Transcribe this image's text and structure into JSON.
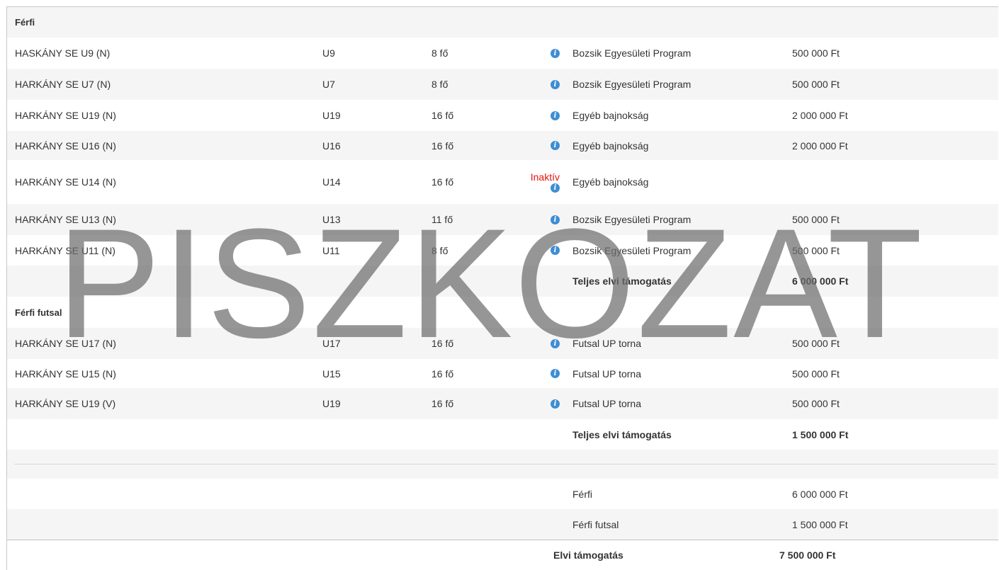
{
  "sections": [
    {
      "title": "Férfi",
      "rows": [
        {
          "name": "HASKÁNY SE U9 (N)",
          "age": "U9",
          "count": "8 fő",
          "program": "Bozsik Egyesületi Program",
          "amount": "500 000 Ft",
          "status": ""
        },
        {
          "name": "HARKÁNY SE U7 (N)",
          "age": "U7",
          "count": "8 fő",
          "program": "Bozsik Egyesületi Program",
          "amount": "500 000 Ft",
          "status": ""
        },
        {
          "name": "HARKÁNY SE U19 (N)",
          "age": "U19",
          "count": "16 fő",
          "program": "Egyéb bajnokság",
          "amount": "2 000 000 Ft",
          "status": ""
        },
        {
          "name": "HARKÁNY SE U16 (N)",
          "age": "U16",
          "count": "16 fő",
          "program": "Egyéb bajnokság",
          "amount": "2 000 000 Ft",
          "status": ""
        },
        {
          "name": "HARKÁNY SE U14 (N)",
          "age": "U14",
          "count": "16 fő",
          "program": "Egyéb bajnokság",
          "amount": "",
          "status": "Inaktív"
        },
        {
          "name": "HARKÁNY SE U13 (N)",
          "age": "U13",
          "count": "11 fő",
          "program": "Bozsik Egyesületi Program",
          "amount": "500 000 Ft",
          "status": ""
        },
        {
          "name": "HARKÁNY SE U11 (N)",
          "age": "U11",
          "count": "8 fő",
          "program": "Bozsik Egyesületi Program",
          "amount": "500 000 Ft",
          "status": ""
        }
      ],
      "total_label": "Teljes elvi támogatás",
      "total_amount": "6 000 000 Ft"
    },
    {
      "title": "Férfi futsal",
      "rows": [
        {
          "name": "HARKÁNY SE U17 (N)",
          "age": "U17",
          "count": "16 fő",
          "program": "Futsal UP torna",
          "amount": "500 000 Ft",
          "status": ""
        },
        {
          "name": "HARKÁNY SE U15 (N)",
          "age": "U15",
          "count": "16 fő",
          "program": "Futsal UP torna",
          "amount": "500 000 Ft",
          "status": ""
        },
        {
          "name": "HARKÁNY SE U19 (V)",
          "age": "U19",
          "count": "16 fő",
          "program": "Futsal UP torna",
          "amount": "500 000 Ft",
          "status": ""
        }
      ],
      "total_label": "Teljes elvi támogatás",
      "total_amount": "1 500 000 Ft"
    }
  ],
  "summary": [
    {
      "label": "Férfi",
      "amount": "6 000 000 Ft"
    },
    {
      "label": "Férfi futsal",
      "amount": "1 500 000 Ft"
    }
  ],
  "grand_total": {
    "label": "Elvi támogatás",
    "amount": "7 500 000 Ft"
  },
  "watermark": "PISZKOZAT",
  "icons": {
    "info": "info-circle-icon"
  },
  "colors": {
    "info": "#3d8ed2",
    "inactive": "#e8120c",
    "row_grey": "#f5f5f5"
  }
}
